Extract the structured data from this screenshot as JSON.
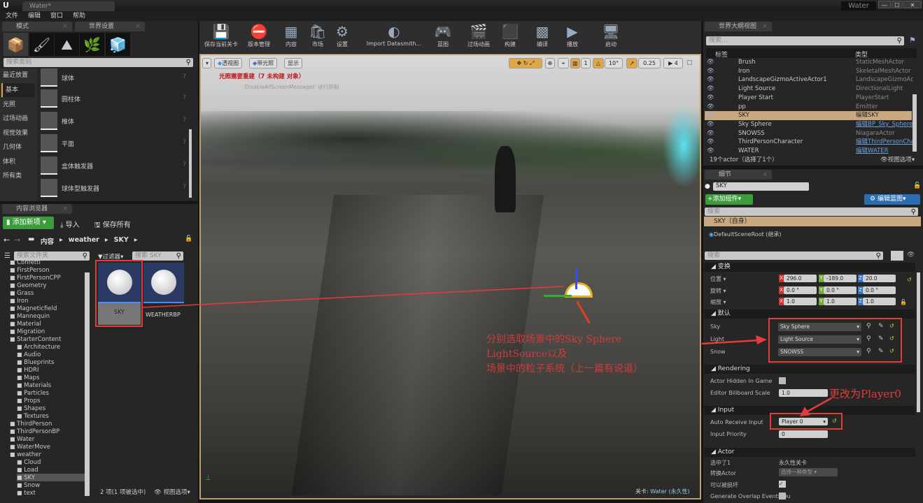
{
  "window": {
    "doc_tab": "Water*",
    "project": "Water",
    "minimize": "—",
    "maximize": "☐",
    "close": "✕"
  },
  "menu": [
    "文件",
    "编辑",
    "窗口",
    "帮助"
  ],
  "modes": {
    "tab": "模式",
    "world_tab": "世界设置",
    "search_placeholder": "搜索类别",
    "categories": [
      "最近放置",
      "基本",
      "光照",
      "过场动画",
      "视觉效果",
      "几何体",
      "体积",
      "所有类"
    ],
    "items": [
      "球体",
      "圆柱体",
      "椎体",
      "平面",
      "盒体触发器",
      "球体型触发器"
    ]
  },
  "content_browser": {
    "tab": "内容浏览器",
    "add_new": "添加新项",
    "import": "导入",
    "save_all": "保存所有",
    "path": [
      "内容",
      "weather",
      "SKY"
    ],
    "folder_search": "搜索文件夹",
    "filter": "过滤器",
    "asset_search": "搜索 SKY",
    "folders": [
      {
        "n": "Confetti",
        "d": 1
      },
      {
        "n": "FirstPerson",
        "d": 1
      },
      {
        "n": "FirstPersonCPP",
        "d": 1
      },
      {
        "n": "Geometry",
        "d": 1
      },
      {
        "n": "Grass",
        "d": 1
      },
      {
        "n": "Iron",
        "d": 1
      },
      {
        "n": "Magneticfield",
        "d": 1
      },
      {
        "n": "Mannequin",
        "d": 1
      },
      {
        "n": "Material",
        "d": 1
      },
      {
        "n": "Migration",
        "d": 1
      },
      {
        "n": "StarterContent",
        "d": 1
      },
      {
        "n": "Architecture",
        "d": 2
      },
      {
        "n": "Audio",
        "d": 2
      },
      {
        "n": "Blueprints",
        "d": 2
      },
      {
        "n": "HDRI",
        "d": 2
      },
      {
        "n": "Maps",
        "d": 2
      },
      {
        "n": "Materials",
        "d": 2
      },
      {
        "n": "Particles",
        "d": 2
      },
      {
        "n": "Props",
        "d": 2
      },
      {
        "n": "Shapes",
        "d": 2
      },
      {
        "n": "Textures",
        "d": 2
      },
      {
        "n": "ThirdPerson",
        "d": 1
      },
      {
        "n": "ThirdPersonBP",
        "d": 1
      },
      {
        "n": "Water",
        "d": 1
      },
      {
        "n": "WaterMove",
        "d": 1
      },
      {
        "n": "weather",
        "d": 1
      },
      {
        "n": "Cloud",
        "d": 2
      },
      {
        "n": "Load",
        "d": 2
      },
      {
        "n": "SKY",
        "d": 2,
        "sel": true
      },
      {
        "n": "Snow",
        "d": 2
      },
      {
        "n": "text",
        "d": 2
      }
    ],
    "assets": [
      "SKY",
      "WEATHERBP"
    ],
    "status": "2 项(1 项被选中)",
    "view_options": "视图选项"
  },
  "toolbar": [
    {
      "l": "保存当前关卡",
      "i": "💾"
    },
    {
      "l": "版本管理",
      "i": "⛔"
    },
    {
      "l": "内容",
      "i": "▦"
    },
    {
      "l": "市场",
      "i": "🛍"
    },
    {
      "l": "设置",
      "i": "⚙"
    },
    {
      "l": "Import Datasmith...",
      "i": "◐"
    },
    {
      "l": "蓝图",
      "i": "🎮"
    },
    {
      "l": "过场动画",
      "i": "🎬"
    },
    {
      "l": "构建",
      "i": "⬛"
    },
    {
      "l": "编译",
      "i": "▩"
    },
    {
      "l": "播放",
      "i": "▶"
    },
    {
      "l": "启动",
      "i": "🖥"
    }
  ],
  "viewport": {
    "perspective": "透视图",
    "lit": "带光照",
    "show": "显示",
    "warning": "光照需要重建（7 未构建 对象）",
    "warning2": "'DisableAllScreenMessages' 进行抑制",
    "grid": "1",
    "rot": "10°",
    "scale": "0.25",
    "speed": "4",
    "level_label": "关卡:",
    "level": "Water (永久性)"
  },
  "annotations": {
    "note1": [
      "分别选取场景中的Sky Sphere",
      "LightSource以及",
      "场景中的粒子系统（上一篇有说道）"
    ],
    "note2": "更改为Player0"
  },
  "outliner": {
    "tab": "世界大纲视图",
    "search": "搜索...",
    "col_label": "标签",
    "col_type": "类型",
    "rows": [
      {
        "n": "Brush",
        "t": "StaticMeshActor"
      },
      {
        "n": "Iron",
        "t": "SkeletalMeshActor"
      },
      {
        "n": "LandscapeGizmoActiveActor1",
        "t": "LandscapeGizmoActiv"
      },
      {
        "n": "Light Source",
        "t": "DirectionalLight"
      },
      {
        "n": "Player Start",
        "t": "PlayerStart"
      },
      {
        "n": "pp",
        "t": "Emitter"
      },
      {
        "n": "SKY",
        "t": "编辑SKY",
        "sel": true
      },
      {
        "n": "Sky Sphere",
        "t": "编辑BP_Sky_Sphere",
        "link": true
      },
      {
        "n": "SNOWSS",
        "t": "NiagaraActor"
      },
      {
        "n": "ThirdPersonCharacter",
        "t": "编辑ThirdPersonCha",
        "link": true
      },
      {
        "n": "WATER",
        "t": "编辑WATER",
        "link": true
      }
    ],
    "status": "19个actor（选择了1个）",
    "view_options": "视图选项"
  },
  "details": {
    "tab": "细节",
    "name": "SKY",
    "add_component": "添加组件",
    "edit_bp": "编辑蓝图",
    "search": "搜索",
    "self": "SKY（自身）",
    "root": "DefaultSceneRoot (继承)",
    "search2": "搜索",
    "transform": {
      "title": "变换",
      "location": {
        "l": "位置",
        "x": "296.0",
        "y": "-189.0",
        "z": "20.0"
      },
      "rotation": {
        "l": "旋转",
        "x": "0.0 °",
        "y": "0.0 °",
        "z": "0.0 °"
      },
      "scale": {
        "l": "缩放",
        "x": "1.0",
        "y": "1.0",
        "z": "1.0"
      }
    },
    "default": {
      "title": "默认",
      "sky": {
        "l": "Sky",
        "v": "Sky Sphere"
      },
      "light": {
        "l": "Light",
        "v": "Light Source"
      },
      "snow": {
        "l": "Snow",
        "v": "SNOWSS"
      }
    },
    "rendering": {
      "title": "Rendering",
      "hidden": "Actor Hidden In Game",
      "billboard": "Editor Billboard Scale",
      "billboard_v": "1.0"
    },
    "input": {
      "title": "Input",
      "auto": "Auto Receive Input",
      "auto_v": "Player 0",
      "priority": "Input Priority",
      "priority_v": "0"
    },
    "actor": {
      "title": "Actor",
      "selected": "选中了1",
      "selected_v": "永久性关卡",
      "convert": "转换Actor",
      "convert_v": "选择一种类型",
      "destroy": "可以被损坏",
      "overlap": "Generate Overlap Events Du"
    }
  },
  "colors": {
    "accent": "#e0a64a",
    "annotation": "#e53b3b",
    "add_green": "#3c9c3c",
    "edit_blue": "#2a6db0",
    "selected_row": "#c9a880"
  }
}
